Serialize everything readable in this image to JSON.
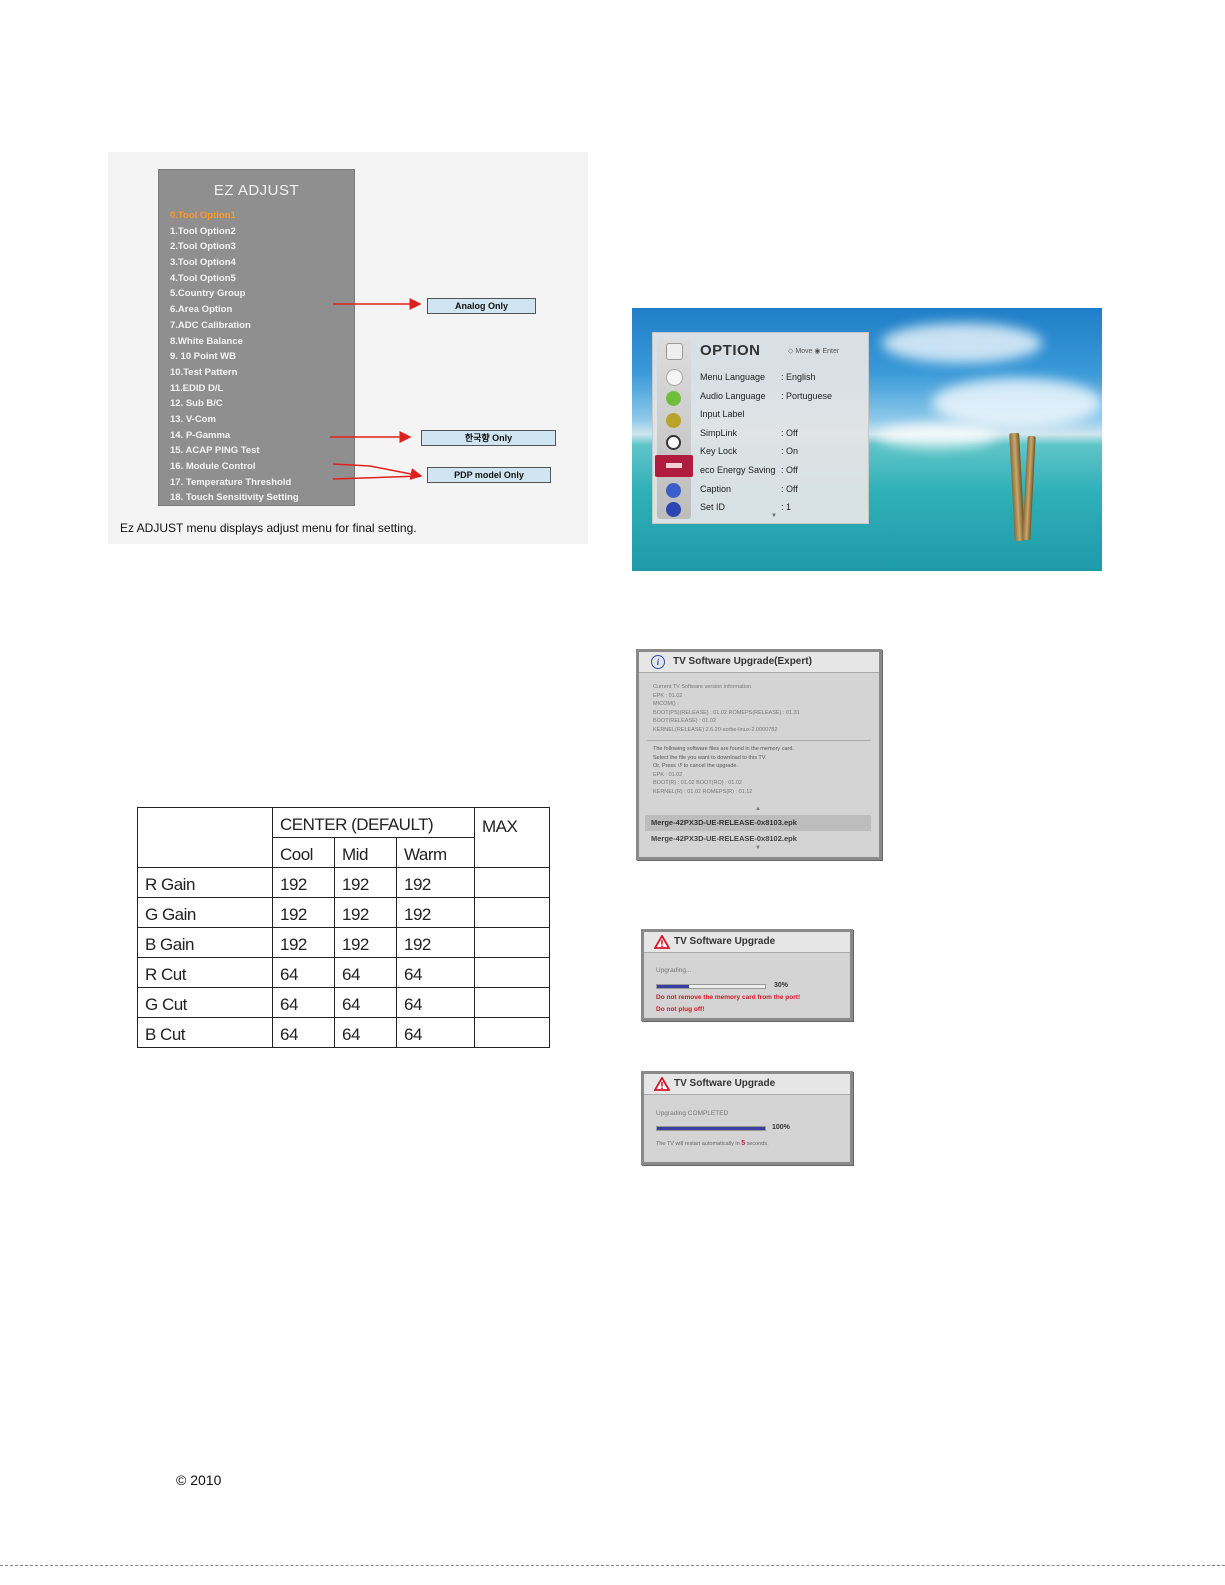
{
  "ez_adjust": {
    "title": "EZ ADJUST",
    "items": [
      "0.Tool Option1",
      "1.Tool Option2",
      "2.Tool Option3",
      "3.Tool Option4",
      "4.Tool Option5",
      "5.Country Group",
      "6.Area Option",
      "7.ADC Calibration",
      "8.White Balance",
      "9. 10 Point WB",
      "10.Test Pattern",
      "11.EDID D/L",
      "12. Sub B/C",
      "13. V-Com",
      "14. P-Gamma",
      "15. ACAP PING Test",
      "16. Module Control",
      "17. Temperature Threshold",
      "18. Touch Sensitivity Setting"
    ],
    "callouts": [
      "Analog Only",
      "한국향 Only",
      "PDP model Only"
    ],
    "caption": "Ez ADJUST menu displays adjust menu for final setting.",
    "colors": {
      "menu_bg": "#8f8f8f",
      "selected_item": "#ff9a1f",
      "arrow": "#e0201c"
    }
  },
  "white_balance_table": {
    "group_header": "CENTER (DEFAULT)",
    "max_header": "MAX",
    "sub_headers": [
      "Cool",
      "Mid",
      "Warm"
    ],
    "rows": [
      {
        "label": "R Gain",
        "cool": "192",
        "mid": "192",
        "warm": "192",
        "max": ""
      },
      {
        "label": "G Gain",
        "cool": "192",
        "mid": "192",
        "warm": "192",
        "max": ""
      },
      {
        "label": "B Gain",
        "cool": "192",
        "mid": "192",
        "warm": "192",
        "max": ""
      },
      {
        "label": "R Cut",
        "cool": "64",
        "mid": "64",
        "warm": "64",
        "max": ""
      },
      {
        "label": "G Cut",
        "cool": "64",
        "mid": "64",
        "warm": "64",
        "max": ""
      },
      {
        "label": "B Cut",
        "cool": "64",
        "mid": "64",
        "warm": "64",
        "max": ""
      }
    ]
  },
  "option_menu": {
    "title": "OPTION",
    "hint": "◇ Move  ◉ Enter",
    "items": [
      {
        "label": "Menu Language",
        "value": ": English"
      },
      {
        "label": "Audio Language",
        "value": ": Portuguese"
      },
      {
        "label": "Input Label",
        "value": ""
      },
      {
        "label": "SimpLink",
        "value": ": Off"
      },
      {
        "label": "Key Lock",
        "value": ": On"
      },
      {
        "label": "eco Energy Saving",
        "value": ": Off"
      },
      {
        "label": "Caption",
        "value": ": Off"
      },
      {
        "label": "Set ID",
        "value": ": 1"
      }
    ]
  },
  "upgrade_expert": {
    "title": "TV Software Upgrade(Expert)",
    "info_lines": [
      "Current TV Software version information",
      "EPK : 01.02",
      "MICOM() :",
      "BOOT(PS)(RELEASE) : 01.02    ROMEPS(RELEASE) : 01.31",
      "BOOT(RELEASE) : 01.02",
      "KERNEL(RELEASE) 2.6.20-sorbe-linux-2.0000782"
    ],
    "notice_lines": [
      "The following software files are found in the memory card.",
      "Select the file you want to download to this TV.",
      "Or, Press ↺ to cancel the upgrade.",
      "EPK : 01.02",
      "BOOT(R) : 01.02 BOOT(RO) : 01.02",
      "KERNEL(R) : 01.02 ROMEPS(R) : 01.12"
    ],
    "files": [
      "Merge-42PX3D-UE-RELEASE-0x8103.epk",
      "Merge-42PX3D-UE-RELEASE-0x8102.epk"
    ]
  },
  "upgrade_progress": {
    "title": "TV Software Upgrade",
    "status": "Upgrading...",
    "percent_label": "30%",
    "progress": 0.3,
    "warning1": "Do not remove the memory card from the port!",
    "warning2": "Do not plug off!"
  },
  "upgrade_done": {
    "title": "TV Software Upgrade",
    "status": "Upgrading COMPLETED",
    "percent_label": "100%",
    "progress": 1.0,
    "restart_prefix": "The TV will restart automatically in ",
    "restart_seconds": "5",
    "restart_suffix": " seconds."
  },
  "copyright": "© 2010"
}
